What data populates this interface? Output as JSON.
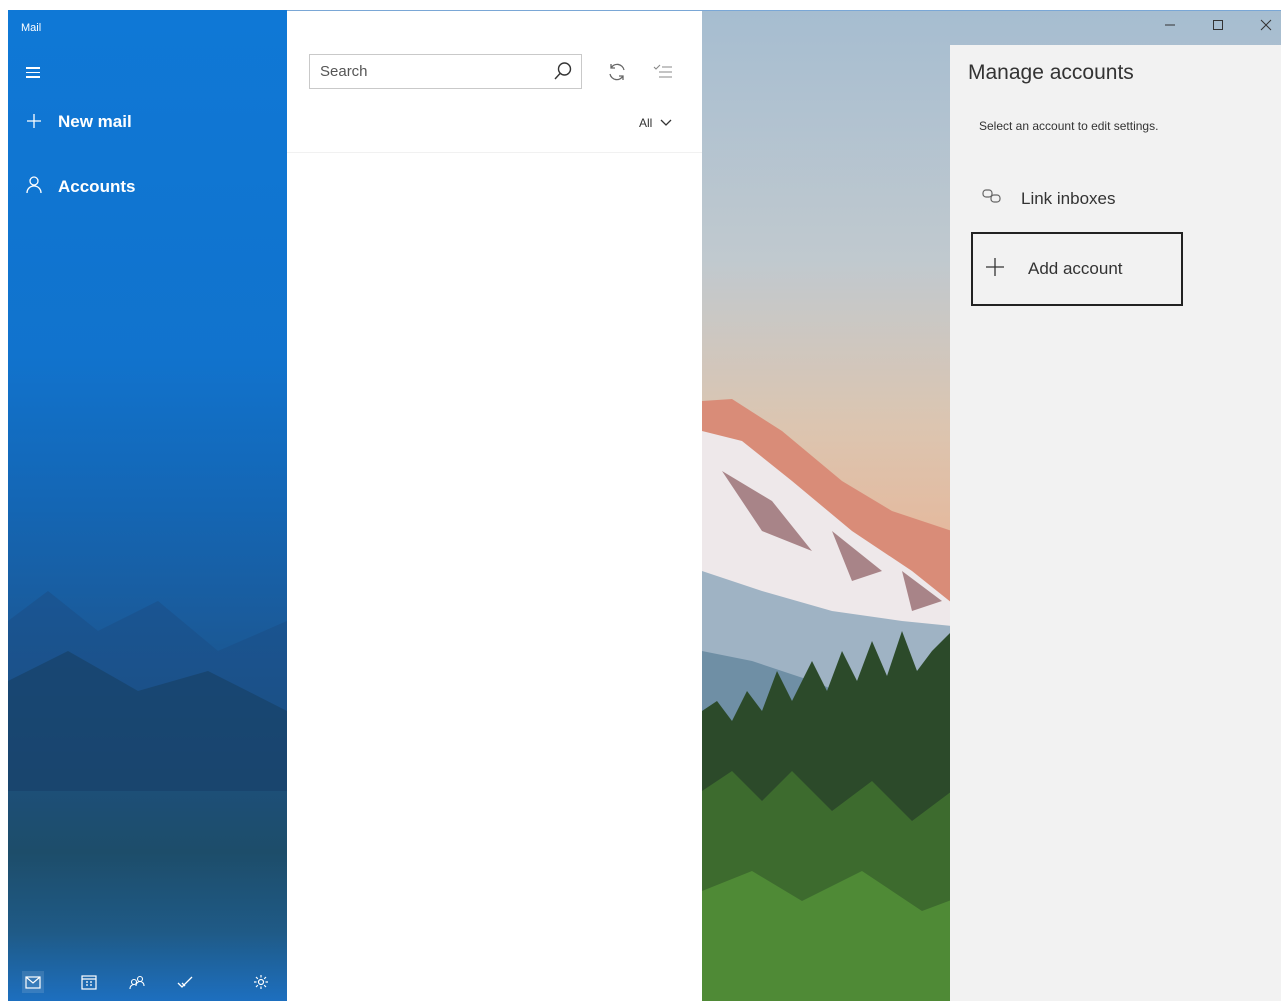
{
  "app": {
    "title": "Mail"
  },
  "sidebar": {
    "new_mail": "New mail",
    "accounts": "Accounts"
  },
  "message_list": {
    "search_placeholder": "Search",
    "filter": "All"
  },
  "manage_accounts": {
    "title": "Manage accounts",
    "subtitle": "Select an account to edit settings.",
    "link_inboxes": "Link inboxes",
    "add_account": "Add account"
  },
  "icons": {
    "hamburger": "hamburger-icon",
    "new_mail": "plus-icon",
    "accounts": "person-icon",
    "search": "search-icon",
    "sync": "sync-icon",
    "select": "select-mode-icon",
    "filter": "chevron-down-icon",
    "link_inboxes": "link-icon",
    "add_account": "plus-icon",
    "mail": "mail-icon",
    "calendar": "calendar-icon",
    "people": "people-icon",
    "todo": "todo-icon",
    "settings": "gear-icon",
    "minimize": "minimize-icon",
    "maximize": "maximize-icon",
    "close": "close-icon"
  },
  "colors": {
    "accent": "#0f78d6",
    "panel_bg": "#f2f2f2"
  }
}
